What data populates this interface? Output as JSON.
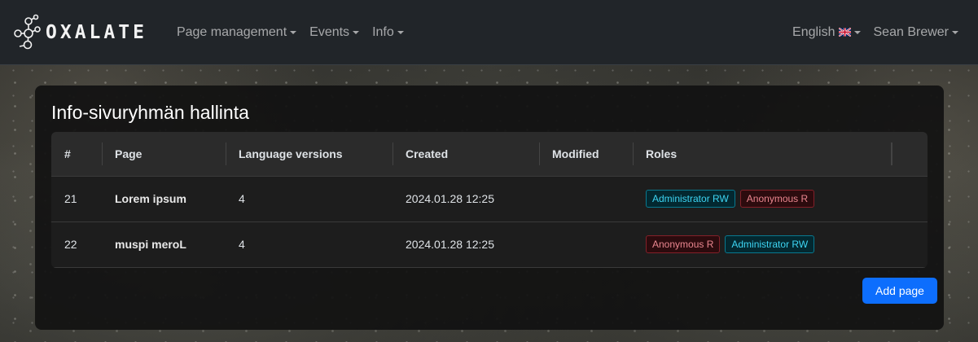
{
  "brand": {
    "name": "OXALATE"
  },
  "nav": {
    "left": [
      {
        "label": "Page management"
      },
      {
        "label": "Events"
      },
      {
        "label": "Info"
      }
    ],
    "language": "English",
    "user": "Sean Brewer"
  },
  "card": {
    "title": "Info-sivuryhmän hallinta",
    "columns": [
      "#",
      "Page",
      "Language versions",
      "Created",
      "Modified",
      "Roles"
    ],
    "rows": [
      {
        "id": "21",
        "page": "Lorem ipsum",
        "language_versions": "4",
        "created": "2024.01.28 12:25",
        "modified": "",
        "roles": [
          {
            "label": "Administrator RW",
            "color": "#3dd5f3"
          },
          {
            "label": "Anonymous R",
            "color": "#ea868f"
          }
        ]
      },
      {
        "id": "22",
        "page": "muspi meroL",
        "language_versions": "4",
        "created": "2024.01.28 12:25",
        "modified": "",
        "roles": [
          {
            "label": "Anonymous R",
            "color": "#ea868f"
          },
          {
            "label": "Administrator RW",
            "color": "#3dd5f3"
          }
        ]
      }
    ],
    "add_button": "Add page"
  },
  "colors": {
    "navbar": "#212529",
    "primary": "#0d6efd",
    "info": "#3dd5f3",
    "danger": "#ea868f"
  }
}
